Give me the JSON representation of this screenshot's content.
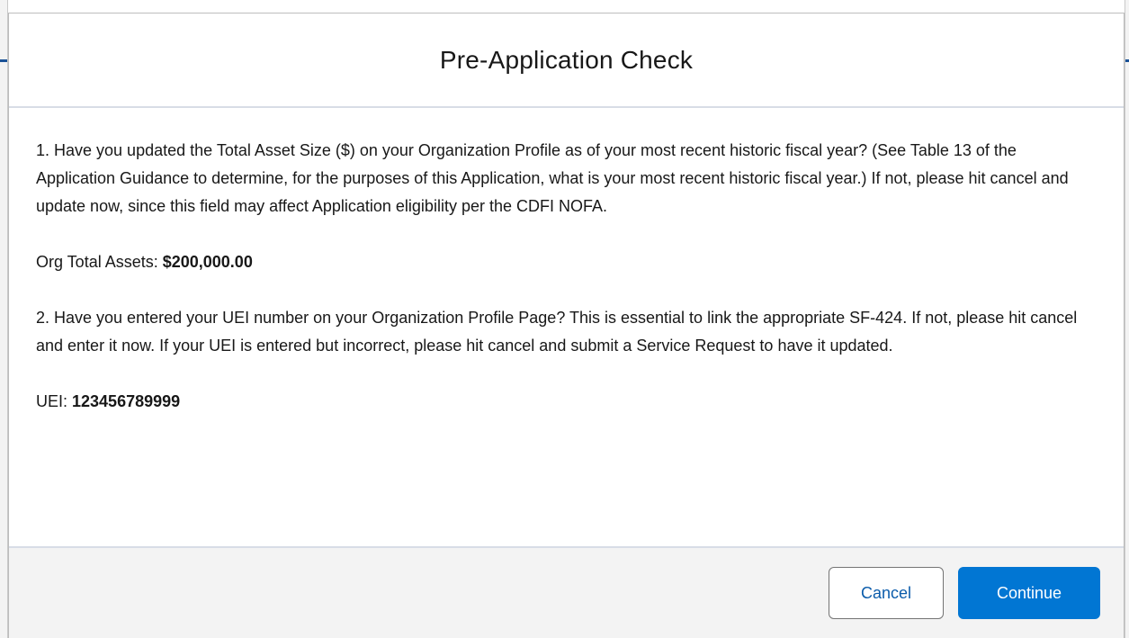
{
  "modal": {
    "title": "Pre-Application Check",
    "question1": "1. Have you updated the Total Asset Size ($) on your Organization Profile as of your most recent historic fiscal year? (See Table 13 of the Application Guidance to determine, for the purposes of this Application, what is your most recent historic fiscal year.) If not, please hit cancel and update now, since this field may affect Application eligibility per the CDFI NOFA.",
    "assets_label": "Org Total Assets: ",
    "assets_value": "$200,000.00",
    "question2": "2. Have you entered your UEI number on your Organization Profile Page? This is essential to link the appropriate SF-424. If not, please hit cancel and enter it now. If your UEI is entered but incorrect, please hit cancel and submit a Service Request to have it updated.",
    "uei_label": "UEI: ",
    "uei_value": "123456789999"
  },
  "footer": {
    "cancel_label": "Cancel",
    "continue_label": "Continue"
  },
  "colors": {
    "primary": "#0176d3",
    "footer_bg": "#f3f3f3",
    "divider": "#d8dde6",
    "text": "#181818"
  }
}
